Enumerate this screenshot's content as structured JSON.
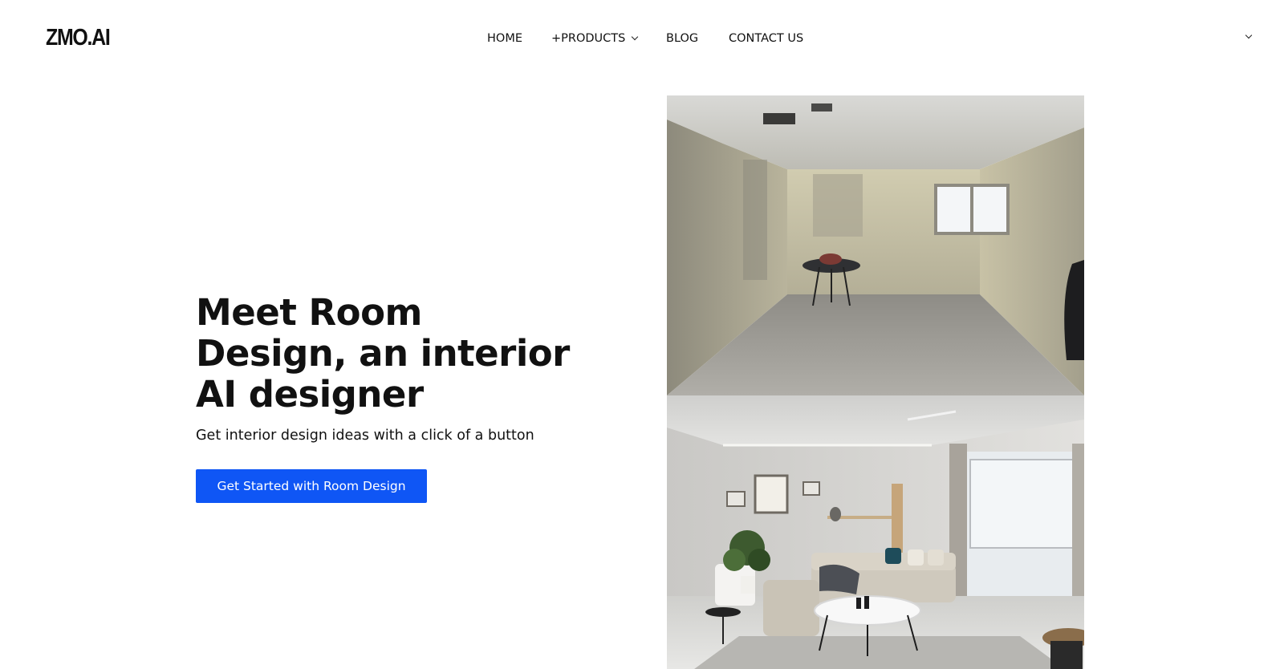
{
  "brand": {
    "logo_text": "ZMO.AI"
  },
  "nav": {
    "items": [
      {
        "label": "HOME"
      },
      {
        "label": "+PRODUCTS",
        "has_dropdown": true
      },
      {
        "label": "BLOG"
      },
      {
        "label": "CONTACT US"
      }
    ],
    "language_dropdown_icon": "chevron-down-icon"
  },
  "hero": {
    "title": "Meet Room Design, an interior AI designer",
    "subtitle": "Get interior design ideas with a click of a button",
    "cta_label": "Get Started with Room Design"
  },
  "images": {
    "before": {
      "depicts": "unfinished-concrete-room"
    },
    "after": {
      "depicts": "designed-living-room"
    }
  },
  "colors": {
    "cta_background": "#0f56f5",
    "cta_text": "#ffffff",
    "text": "#111111",
    "background": "#ffffff"
  }
}
